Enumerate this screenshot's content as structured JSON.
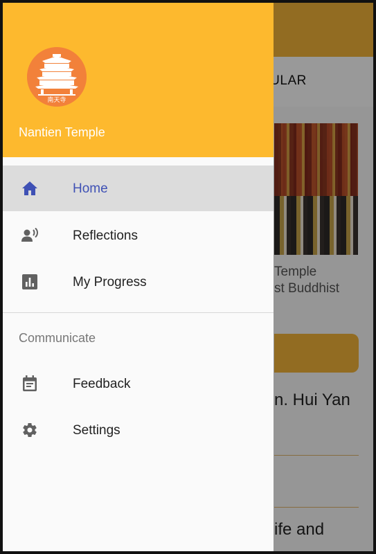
{
  "background": {
    "tab_label": "PULAR",
    "card": {
      "line1": "Temple",
      "line2": "st Buddhist"
    },
    "name_text": "n. Hui Yan",
    "life_text": "ife and"
  },
  "drawer": {
    "title": "Nantien Temple",
    "logo_text": "南天寺",
    "items": [
      {
        "label": "Home",
        "icon": "home-icon",
        "active": true
      },
      {
        "label": "Reflections",
        "icon": "record-voice-icon",
        "active": false
      },
      {
        "label": "My Progress",
        "icon": "bar-chart-icon",
        "active": false
      }
    ],
    "section_label": "Communicate",
    "communicate_items": [
      {
        "label": "Feedback",
        "icon": "calendar-note-icon"
      },
      {
        "label": "Settings",
        "icon": "gear-icon"
      }
    ]
  },
  "colors": {
    "header": "#fdb92e",
    "appbar": "#f3b53a",
    "accent": "#3f51b5",
    "icon": "#616161",
    "logo_bg": "#f2813a"
  }
}
